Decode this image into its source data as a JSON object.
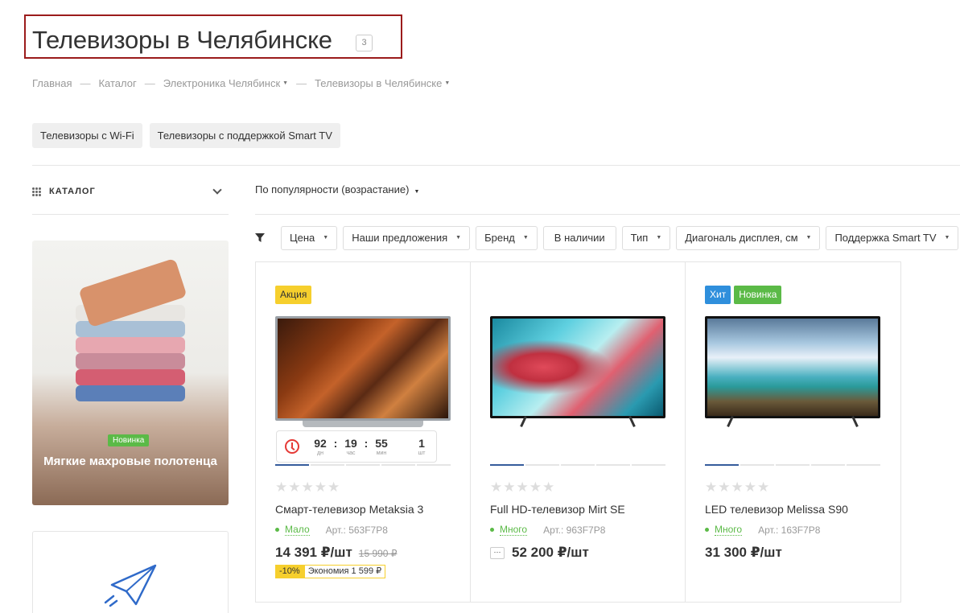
{
  "page": {
    "title": "Телевизоры в Челябинске",
    "count": "3"
  },
  "breadcrumb": [
    {
      "label": "Главная"
    },
    {
      "label": "Каталог"
    },
    {
      "label": "Электроника Челябинск"
    },
    {
      "label": "Телевизоры в Челябинске"
    }
  ],
  "tags": [
    "Телевизоры с Wi-Fi",
    "Телевизоры с поддержкой Smart TV"
  ],
  "sidebar": {
    "catalog_label": "КАТАЛОГ",
    "promo": {
      "badge": "Новинка",
      "title": "Мягкие махровые полотенца"
    }
  },
  "sort": {
    "label": "По популярности (возрастание)"
  },
  "filters": [
    {
      "label": "Цена",
      "dropdown": true
    },
    {
      "label": "Наши предложения",
      "dropdown": true
    },
    {
      "label": "Бренд",
      "dropdown": true
    },
    {
      "label": "В наличии",
      "dropdown": false
    },
    {
      "label": "Тип",
      "dropdown": true
    },
    {
      "label": "Диагональ дисплея, см",
      "dropdown": true
    },
    {
      "label": "Поддержка Smart TV",
      "dropdown": true
    }
  ],
  "products": [
    {
      "badges": [
        {
          "label": "Акция",
          "type": "sale"
        }
      ],
      "timer": {
        "days": "92",
        "days_label": "дн",
        "hours": "19",
        "hours_label": "час",
        "minutes": "55",
        "minutes_label": "мин",
        "qty": "1",
        "qty_label": "шт"
      },
      "name": "Смарт-телевизор Metaksia 3",
      "stock": "Мало",
      "article": "Арт.: 563F7P8",
      "price": "14 391 ₽/шт",
      "old_price": "15 990 ₽",
      "discount_pct": "-10%",
      "saving": "Экономия 1 599 ₽"
    },
    {
      "badges": [],
      "name": "Full HD-телевизор Mirt SE",
      "stock": "Много",
      "article": "Арт.: 963F7P8",
      "more_icon": "···",
      "price": "52 200 ₽/шт"
    },
    {
      "badges": [
        {
          "label": "Хит",
          "type": "hit"
        },
        {
          "label": "Новинка",
          "type": "new"
        }
      ],
      "name": "LED телевизор Melissa S90",
      "stock": "Много",
      "article": "Арт.: 163F7P8",
      "price": "31 300 ₽/шт"
    }
  ],
  "colors": {
    "accent": "#365c9c",
    "stock_green": "#5bba47",
    "sale_yellow": "#f6cf2d",
    "hit_blue": "#2f8fdc",
    "title_frame": "#9b1b1b"
  }
}
